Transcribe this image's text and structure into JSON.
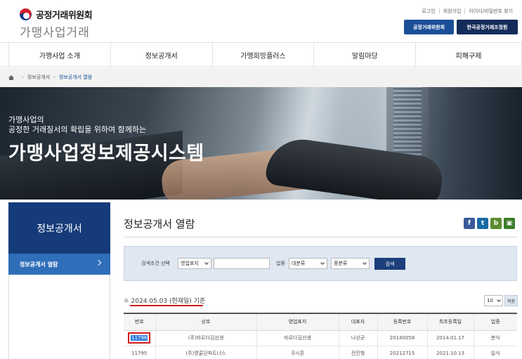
{
  "header": {
    "org_name": "공정거래위원회",
    "site_name": "가맹사업거래",
    "util_links": [
      "로그인",
      "회원가입",
      "아이디/비밀번호 찾기"
    ],
    "btn_ftc": "공정거래위원회",
    "btn_kfair": "한국공정거래조정원"
  },
  "gnb": [
    "가맹사업 소개",
    "정보공개서",
    "가맹희망플러스",
    "알림마당",
    "피해구제"
  ],
  "breadcrumb": [
    "정보공개서",
    "정보공개서 열람"
  ],
  "banner": {
    "line1": "가맹사업의",
    "line2": "공정한 거래질서의 확립을 위하여 함께하는",
    "title": "가맹사업정보제공시스템"
  },
  "sidebar": {
    "title": "정보공개서",
    "menu_item": "정보공개서 열람"
  },
  "content": {
    "title": "정보공개서 열람",
    "sns_icons": [
      "facebook-icon",
      "twitter-icon",
      "blog-icon",
      "print-icon"
    ]
  },
  "search": {
    "label": "검색조건 선택",
    "condition_value": "영업표지",
    "industry_label": "업종",
    "major_value": "대분류",
    "minor_value": "중분류",
    "button": "검색"
  },
  "basis": {
    "asterisk": "※",
    "text": "2024.05.03 (현재일) 기준"
  },
  "paging": {
    "size_value": "10",
    "apply": "적용"
  },
  "table": {
    "headers": [
      "번호",
      "상호",
      "영업표지",
      "대표자",
      "등록번호",
      "최초등록일",
      "업종"
    ],
    "rows": [
      [
        "11796",
        "(주)바르다김선생",
        "바르다김선생",
        "나상균",
        "20140058",
        "2014.01.17",
        "분식"
      ],
      [
        "11795",
        "(주)명륜당파트너스",
        "쿠시혼",
        "전진형",
        "20212715",
        "2021.10.13",
        "일식"
      ]
    ]
  }
}
